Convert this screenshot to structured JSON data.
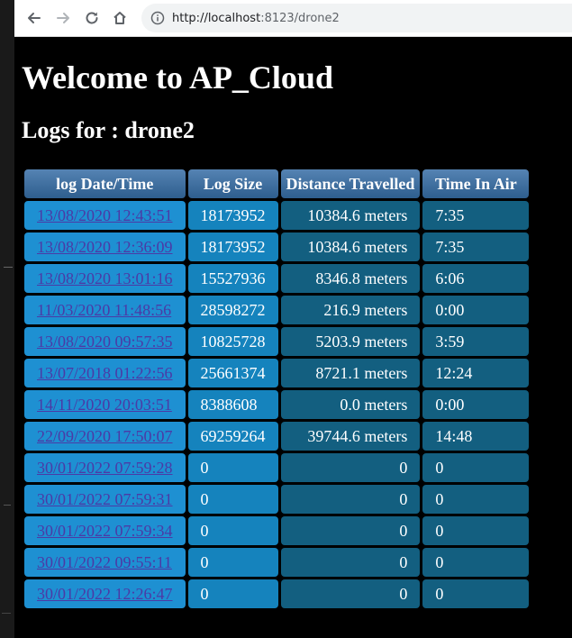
{
  "browser": {
    "url_host": "http://localhost",
    "url_rest": ":8123/drone2",
    "icons": [
      "back-icon",
      "forward-icon",
      "reload-icon",
      "home-icon",
      "info-icon"
    ]
  },
  "page": {
    "title": "Welcome to AP_Cloud",
    "subtitle": "Logs for : drone2"
  },
  "table": {
    "headers": [
      "log Date/Time",
      "Log Size",
      "Distance Travelled",
      "Time In Air"
    ],
    "rows": [
      {
        "date": "13/08/2020 12:43:51",
        "size": "18173952",
        "distance": "10384.6 meters",
        "time": "7:35"
      },
      {
        "date": "13/08/2020 12:36:09",
        "size": "18173952",
        "distance": "10384.6 meters",
        "time": "7:35"
      },
      {
        "date": "13/08/2020 13:01:16",
        "size": "15527936",
        "distance": "8346.8 meters",
        "time": "6:06"
      },
      {
        "date": "11/03/2020 11:48:56",
        "size": "28598272",
        "distance": "216.9 meters",
        "time": "0:00"
      },
      {
        "date": "13/08/2020 09:57:35",
        "size": "10825728",
        "distance": "5203.9 meters",
        "time": "3:59"
      },
      {
        "date": "13/07/2018 01:22:56",
        "size": "25661374",
        "distance": "8721.1 meters",
        "time": "12:24"
      },
      {
        "date": "14/11/2020 20:03:51",
        "size": "8388608",
        "distance": "0.0 meters",
        "time": "0:00"
      },
      {
        "date": "22/09/2020 17:50:07",
        "size": "69259264",
        "distance": "39744.6 meters",
        "time": "14:48"
      },
      {
        "date": "30/01/2022 07:59:28",
        "size": "0",
        "distance": "0",
        "time": "0"
      },
      {
        "date": "30/01/2022 07:59:31",
        "size": "0",
        "distance": "0",
        "time": "0"
      },
      {
        "date": "30/01/2022 07:59:34",
        "size": "0",
        "distance": "0",
        "time": "0"
      },
      {
        "date": "30/01/2022 09:55:11",
        "size": "0",
        "distance": "0",
        "time": "0"
      },
      {
        "date": "30/01/2022 12:26:47",
        "size": "0",
        "distance": "0",
        "time": "0"
      }
    ]
  },
  "colors": {
    "header_bg": "#2e5e8e",
    "date_cell": "#1e90d2",
    "size_cell": "#1583bd",
    "dark_cell": "#135f80",
    "link": "#4b3aa6"
  }
}
